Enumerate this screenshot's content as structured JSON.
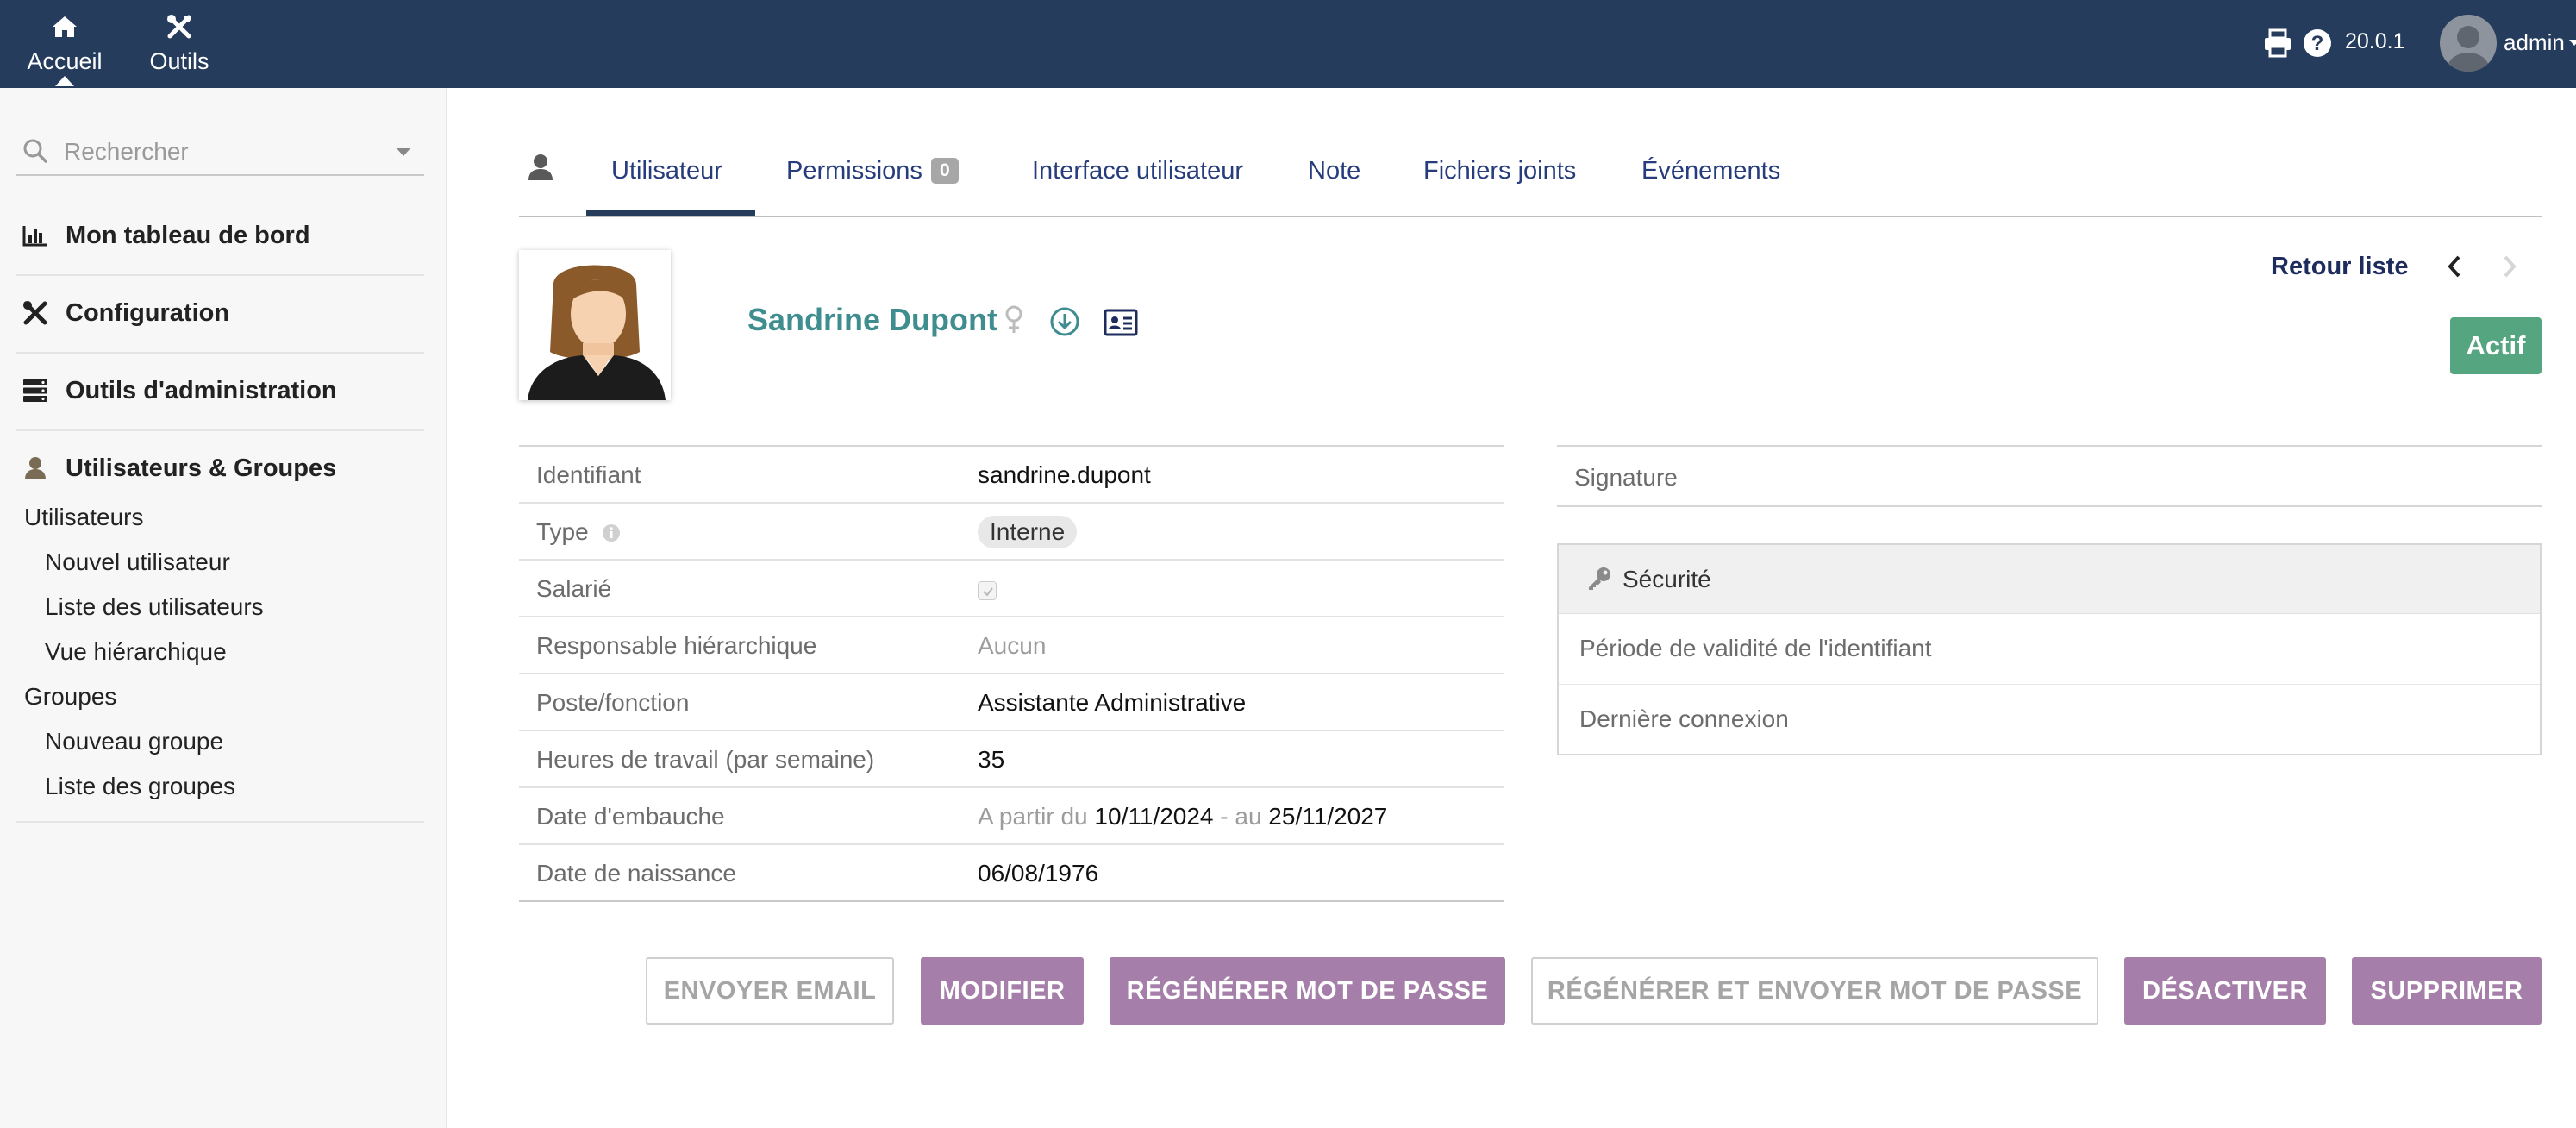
{
  "topbar": {
    "menus": [
      {
        "label": "Accueil",
        "icon": "home-icon"
      },
      {
        "label": "Outils",
        "icon": "tools-icon"
      }
    ],
    "version": "20.0.1",
    "user": "admin",
    "bar_color": "#263c5c"
  },
  "sidebar": {
    "search_placeholder": "Rechercher",
    "sections": [
      {
        "label": "Mon tableau de bord",
        "icon": "chart-icon"
      },
      {
        "label": "Configuration",
        "icon": "tools-icon"
      },
      {
        "label": "Outils d'administration",
        "icon": "server-icon"
      },
      {
        "label": "Utilisateurs & Groupes",
        "icon": "user-icon"
      }
    ],
    "users_group": {
      "title": "Utilisateurs",
      "items": [
        "Nouvel utilisateur",
        "Liste des utilisateurs",
        "Vue hiérarchique"
      ]
    },
    "groups_group": {
      "title": "Groupes",
      "items": [
        "Nouveau groupe",
        "Liste des groupes"
      ]
    }
  },
  "tabs": {
    "items": [
      "Utilisateur",
      "Permissions",
      "Interface utilisateur",
      "Note",
      "Fichiers joints",
      "Événements"
    ],
    "permissions_badge": "0",
    "active": "Utilisateur"
  },
  "header": {
    "name": "Sandrine Dupont",
    "back_link": "Retour liste",
    "status": "Actif",
    "status_color": "#55a580",
    "name_color": "#3f8d8f"
  },
  "info": {
    "identifiant": {
      "label": "Identifiant",
      "value": "sandrine.dupont"
    },
    "type": {
      "label": "Type",
      "value": "Interne"
    },
    "salarie": {
      "label": "Salarié",
      "checked": true
    },
    "responsable": {
      "label": "Responsable hiérarchique",
      "value": "Aucun"
    },
    "poste": {
      "label": "Poste/fonction",
      "value": "Assistante Administrative"
    },
    "heures": {
      "label": "Heures de travail (par semaine)",
      "value": "35"
    },
    "embauche": {
      "label": "Date d'embauche",
      "from_label": "A partir du",
      "from": "10/11/2024",
      "to_label": "- au",
      "to": "25/11/2027"
    },
    "naissance": {
      "label": "Date de naissance",
      "value": "06/08/1976"
    }
  },
  "right": {
    "signature_label": "Signature",
    "security": {
      "title": "Sécurité",
      "rows": [
        "Période de validité de l'identifiant",
        "Dernière connexion"
      ]
    }
  },
  "actions": {
    "send_email": "ENVOYER EMAIL",
    "modify": "MODIFIER",
    "regen_password": "RÉGÉNÉRER MOT DE PASSE",
    "regen_send_password": "RÉGÉNÉRER ET ENVOYER MOT DE PASSE",
    "deactivate": "DÉSACTIVER",
    "delete": "SUPPRIMER",
    "button_color": "#a57fa9"
  }
}
